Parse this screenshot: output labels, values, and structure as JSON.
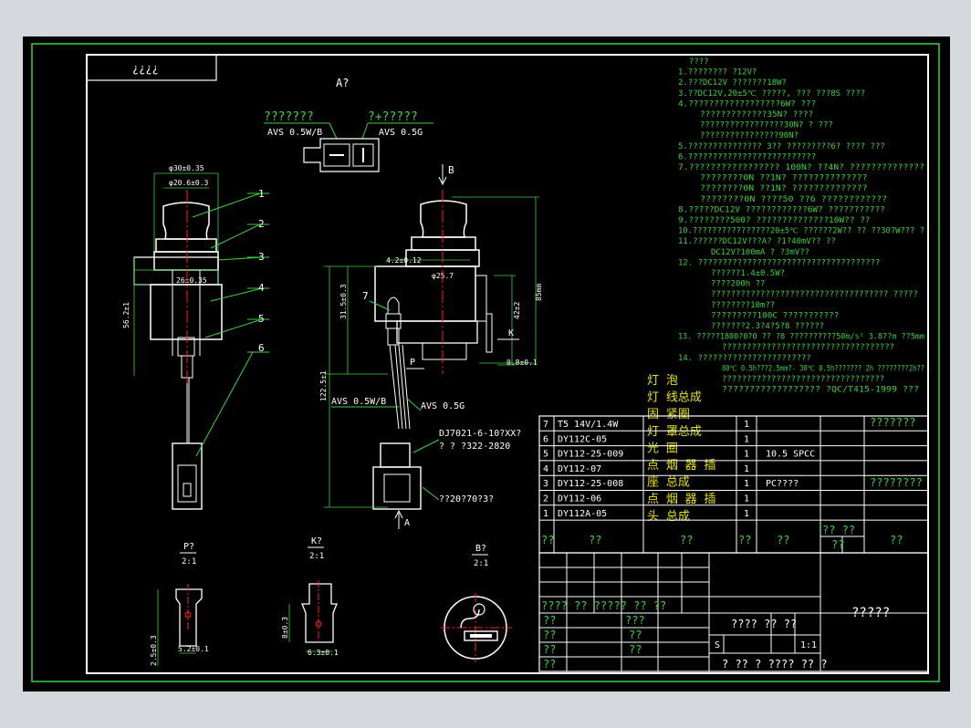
{
  "corner_label": "¿¿¿¿",
  "view_a_label": "A?",
  "view_b_label": "B",
  "arrow_a_label": "A",
  "connector": {
    "left_label": "???????",
    "left_wire": "AVS 0.5W/B",
    "right_label": "?+?????",
    "right_wire": "AVS 0.5G",
    "pin_minus": "-",
    "pin_plus": "|"
  },
  "left_view_dims": {
    "d1": "φ30±0.35",
    "d2": "φ20.6±0.3",
    "d3": "26±0.35",
    "height": "56.2±1"
  },
  "part_callouts": [
    "1",
    "2",
    "3",
    "4",
    "5",
    "6"
  ],
  "side_view_dims": {
    "d1": "4.2±0.12",
    "d2": "φ25.7",
    "h1": "31.5±0.3",
    "h2": "42±2",
    "h3": "122.5±1",
    "d4": "0.8±0.1",
    "label7": "7",
    "labelK": "K",
    "labelP": "P",
    "wire1": "AVS 0.5W/B",
    "wire2": "AVS 0.5G",
    "conn1": "DJ7021-6-10?XX?",
    "conn2": "? ? ?322-2820",
    "conn3": "??20?70?3?",
    "height_mm": "85mm"
  },
  "details": [
    {
      "title": "P?",
      "scale": "2:1",
      "dim_v": "2.5±0.3",
      "dim_h": "5.2±0.1"
    },
    {
      "title": "K?",
      "scale": "2:1",
      "dim_v": "8±0.3",
      "dim_h": "6.3±0.1"
    },
    {
      "title": "B?",
      "scale": "2:1"
    }
  ],
  "notes": [
    {
      "text": "????",
      "indent": 1
    },
    {
      "text": "1.???????? ?12V?",
      "indent": 0
    },
    {
      "text": "2.???DC12V ???????18W?",
      "indent": 0
    },
    {
      "text": "3.??DC12V,20±5℃ ?????, ??? ???8S  ????",
      "indent": 0
    },
    {
      "text": "4.??????????????????6W?  ???",
      "indent": 0
    },
    {
      "text": "?????????????35N?  ????",
      "indent": 2
    },
    {
      "text": "?????????????????30N? ? ???",
      "indent": 2
    },
    {
      "text": "????????????????90N?",
      "indent": 2
    },
    {
      "text": "5.??????????????? 3?? ?????????6? ???? ???",
      "indent": 0
    },
    {
      "text": "6.??????????????????????????",
      "indent": 0
    },
    {
      "text": "7.????????????????? 100N?   ??4N?     ??????????????",
      "indent": 0
    },
    {
      "text": "????????0N  ??1N?   ??????????????",
      "indent": 2
    },
    {
      "text": "????????0N  ??1N?   ??????????????",
      "indent": 2
    },
    {
      "text": "????????0N  ????50  ??6   ????????????",
      "indent": 2
    },
    {
      "text": "8.?????DC12V ????????????6W?   ???????????",
      "indent": 0
    },
    {
      "text": "9.????????500? ??????????????10W??   ??",
      "indent": 0
    },
    {
      "text": "10.????????????????20±5℃  ??????2W?? ??  ??30?W???   ?",
      "indent": 0
    },
    {
      "text": "11.??????DC12V???A? ?1?40mV?? ??",
      "indent": 0
    },
    {
      "text": "DC12V?100mA ? ?3mV??",
      "indent": 3
    },
    {
      "text": "12. ?????????????????????????????????????",
      "indent": 0
    },
    {
      "text": "??????1.4±0.5W?",
      "indent": 3
    },
    {
      "text": "????200h ??",
      "indent": 3
    },
    {
      "text": "???????????????????????????????????? ?????",
      "indent": 3
    },
    {
      "text": "????????10m??",
      "indent": 3
    },
    {
      "text": "?????????100C  ???????????",
      "indent": 3
    },
    {
      "text": "???????2.3?4?5?8 ??????",
      "indent": 3
    },
    {
      "text": "13. ?????1800?0?0   ?? ?8   ??????????50m/s²  3.8??m ??5mm",
      "indent": 0
    },
    {
      "text": "???????????????????????????????????",
      "indent": 4
    },
    {
      "text": "14. ???????????????????????",
      "indent": 0
    },
    {
      "text": "80℃ 0.5h???2.5mm?- 30℃ 0.5h??????? 2h  ????????2h??",
      "indent": 4
    },
    {
      "text": "?????????????????????????????????",
      "indent": 4
    },
    {
      "text": "?????????????????? ?QC/T415-1999     ???",
      "indent": 4
    }
  ],
  "yellow_overlay": [
    "灯 泡",
    "灯 线总成",
    "固 紧圈",
    "灯 罩总成",
    "光 圈",
    "点 烟 器 插",
    "座 总成",
    "点 烟 器 插",
    "头 总成"
  ],
  "bom_rows": [
    {
      "no": "7",
      "code": "T5 14V/1.4W",
      "qty": "1",
      "material": "",
      "remark": ""
    },
    {
      "no": "6",
      "code": "DY112C-05",
      "qty": "1",
      "material": "",
      "remark": ""
    },
    {
      "no": "5",
      "code": "DY112-25-009",
      "qty": "1",
      "material": "10.5 SPCC",
      "remark": ""
    },
    {
      "no": "4",
      "code": "DY112-07",
      "qty": "1",
      "material": "",
      "remark": ""
    },
    {
      "no": "3",
      "code": "DY112-25-008",
      "qty": "1",
      "material": "PC????",
      "remark": "????????"
    },
    {
      "no": "2",
      "code": "DY112-06",
      "qty": "1",
      "material": "",
      "remark": ""
    },
    {
      "no": "1",
      "code": "DY112A-05",
      "qty": "1",
      "material": "",
      "remark": ""
    }
  ],
  "bom_top_remark": "???????",
  "bom_header": {
    "c1": "??",
    "c2": "??",
    "c3": "??",
    "c4": "??",
    "c5": "??",
    "c6a": "?? ??",
    "c6b": "??",
    "c7": "??"
  },
  "title_block": {
    "row1": "????  ??  ????? ??  ??",
    "r_a": "??",
    "r_b": "??",
    "r_c": "??",
    "r_d": "??",
    "mid1": "???",
    "mid2": "??",
    "mid3": "??",
    "scale_hdr": "????  ??  ??",
    "mark_s": "S",
    "scale": "1:1",
    "footer": "? ?? ? ???? ?? ?",
    "drawing_title": "?????"
  },
  "colors": {
    "background": "#000000",
    "line": "#3cd23c",
    "white": "#ffffff",
    "red": "#ff2020",
    "yellow": "#e8e400",
    "frame": "#d5d9de"
  }
}
